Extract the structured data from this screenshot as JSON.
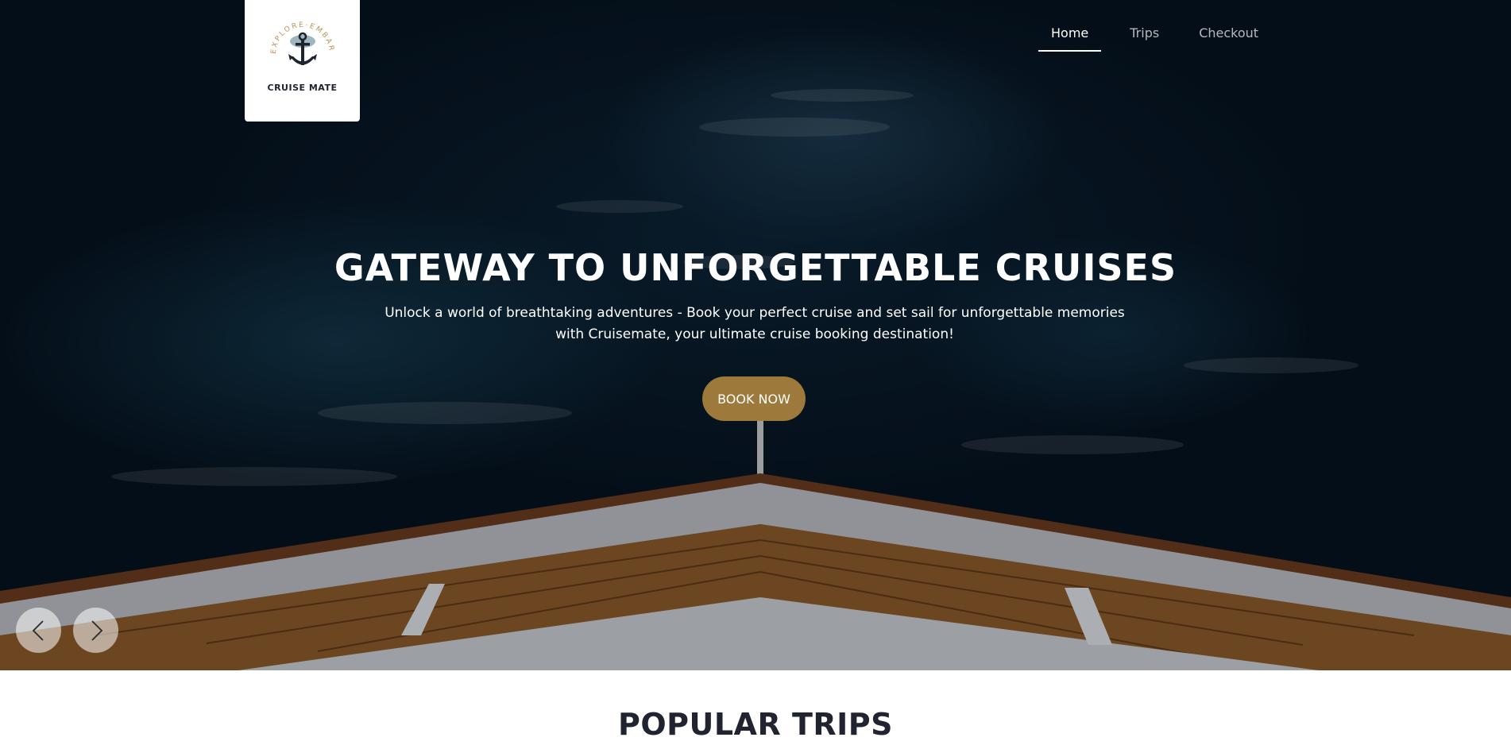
{
  "brand": {
    "name": "CRUISE MATE",
    "tagline": "EXPLORE·EMBARK·ENJOY!"
  },
  "nav": {
    "items": [
      {
        "label": "Home",
        "active": true
      },
      {
        "label": "Trips",
        "active": false
      },
      {
        "label": "Checkout",
        "active": false
      }
    ]
  },
  "hero": {
    "title": "GATEWAY TO UNFORGETTABLE CRUISES",
    "subtitle": "Unlock a world of breathtaking adventures - Book your perfect cruise and set sail for unforgettable memories with Cruisemate, your ultimate cruise booking destination!",
    "cta_label": "BOOK NOW"
  },
  "carousel": {
    "prev_icon": "chevron-left-icon",
    "next_icon": "chevron-right-icon"
  },
  "sections": {
    "popular_title": "POPULAR TRIPS"
  },
  "colors": {
    "accent": "#9d7a3b",
    "dark_text": "#1f2430",
    "ocean": "#0c2336"
  }
}
